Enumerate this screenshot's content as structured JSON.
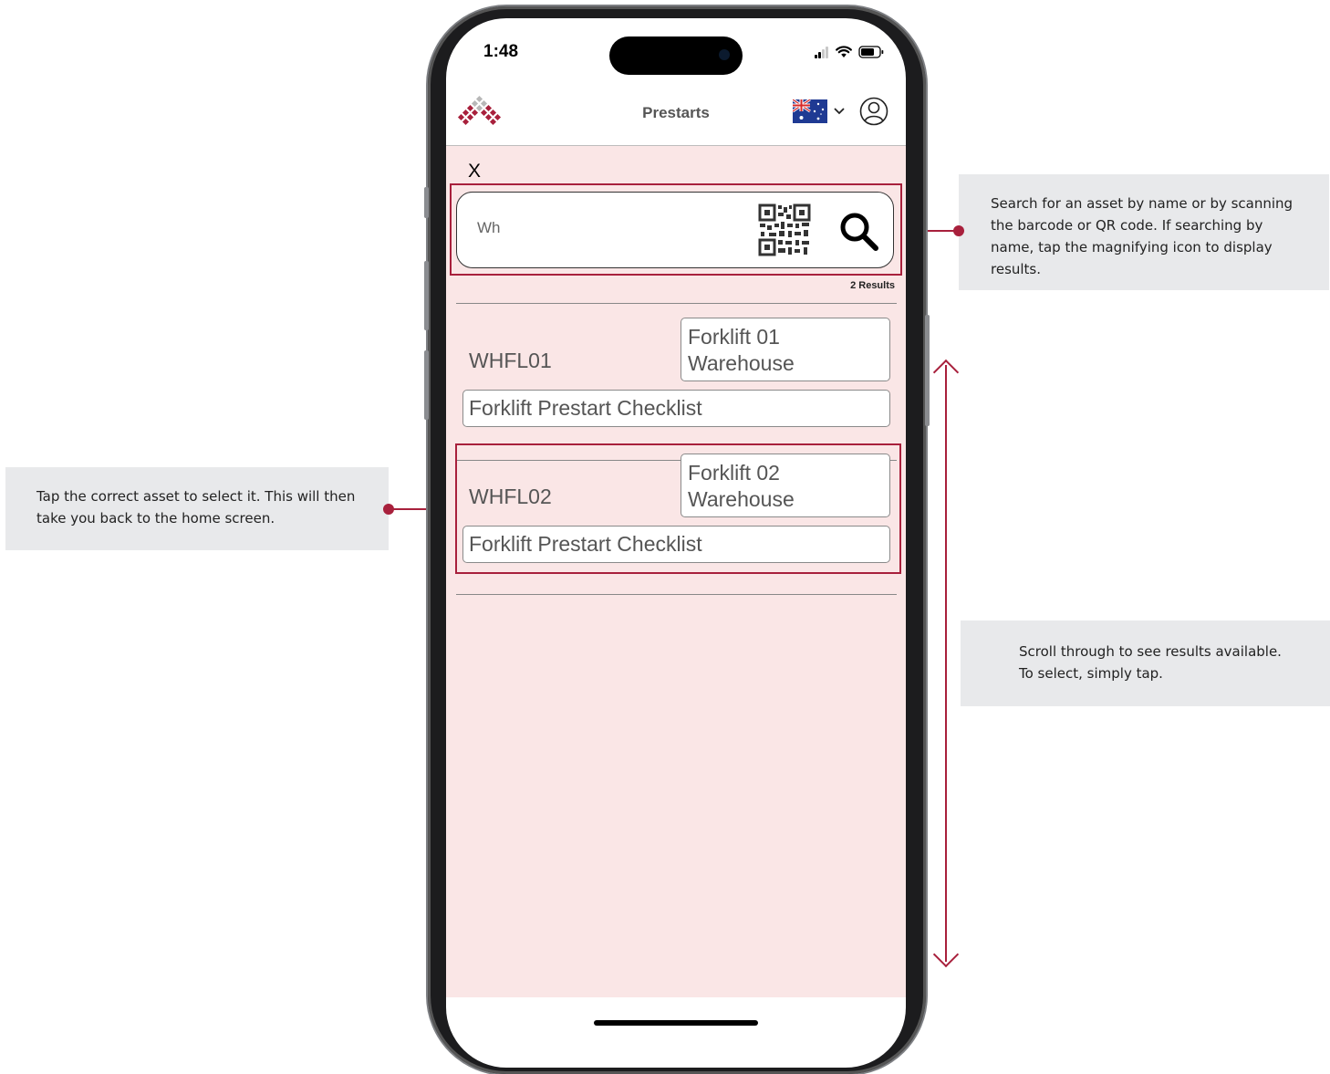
{
  "callouts": {
    "search": "Search for an asset by name or by scanning the barcode or QR code. If searching by name, tap the magnifying icon to display results.",
    "select": "Tap the correct asset to select it. This will then take you back to the home screen.",
    "scroll": "Scroll through to see results available. To select, simply tap."
  },
  "status_bar": {
    "time": "1:48"
  },
  "header": {
    "title": "Prestarts",
    "flag_icon": "australia-flag-icon"
  },
  "search": {
    "close_label": "X",
    "value": "Wh",
    "result_count": "2 Results"
  },
  "results": [
    {
      "code": "WHFL01",
      "name_line1": "Forklift 01",
      "name_line2": "Warehouse",
      "checklist": "Forklift Prestart Checklist"
    },
    {
      "code": "WHFL02",
      "name_line1": "Forklift 02",
      "name_line2": "Warehouse",
      "checklist": "Forklift Prestart Checklist"
    }
  ],
  "colors": {
    "accent": "#a8203c",
    "content_bg": "#fae6e6",
    "callout_bg": "#e8e9eb"
  }
}
